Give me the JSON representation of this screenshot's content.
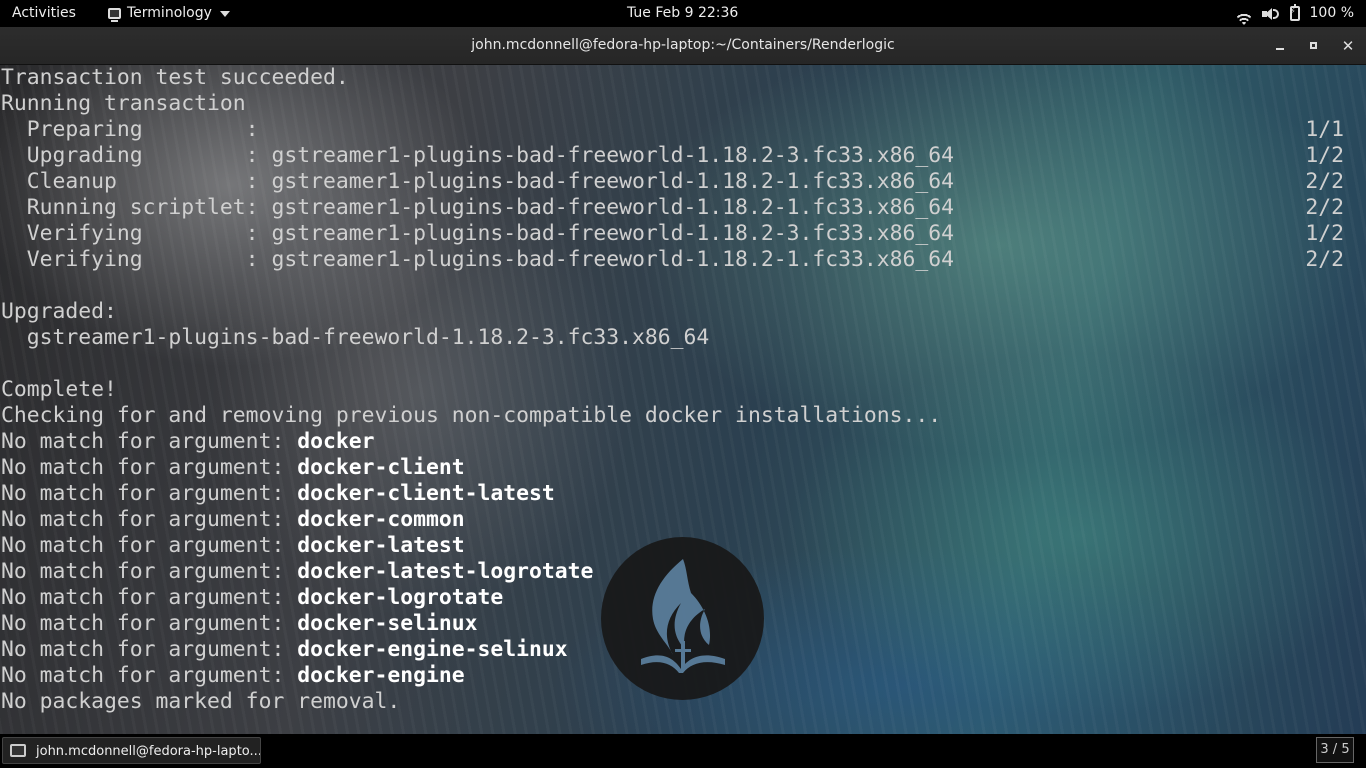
{
  "topbar": {
    "activities": "Activities",
    "app_name": "Terminology",
    "clock": "Tue Feb 9  22:36",
    "battery": "100 %"
  },
  "window": {
    "title": "john.mcdonnell@fedora-hp-laptop:~/Containers/Renderlogic"
  },
  "terminal": {
    "lines": [
      {
        "text": "Transaction test succeeded.",
        "bold": "",
        "right": ""
      },
      {
        "text": "Running transaction",
        "bold": "",
        "right": ""
      },
      {
        "text": "  Preparing        :",
        "bold": "",
        "right": "1/1"
      },
      {
        "text": "  Upgrading        : gstreamer1-plugins-bad-freeworld-1.18.2-3.fc33.x86_64",
        "bold": "",
        "right": "1/2"
      },
      {
        "text": "  Cleanup          : gstreamer1-plugins-bad-freeworld-1.18.2-1.fc33.x86_64",
        "bold": "",
        "right": "2/2"
      },
      {
        "text": "  Running scriptlet: gstreamer1-plugins-bad-freeworld-1.18.2-1.fc33.x86_64",
        "bold": "",
        "right": "2/2"
      },
      {
        "text": "  Verifying        : gstreamer1-plugins-bad-freeworld-1.18.2-3.fc33.x86_64",
        "bold": "",
        "right": "1/2"
      },
      {
        "text": "  Verifying        : gstreamer1-plugins-bad-freeworld-1.18.2-1.fc33.x86_64",
        "bold": "",
        "right": "2/2"
      },
      {
        "text": "",
        "bold": "",
        "right": ""
      },
      {
        "text": "Upgraded:",
        "bold": "",
        "right": ""
      },
      {
        "text": "  gstreamer1-plugins-bad-freeworld-1.18.2-3.fc33.x86_64",
        "bold": "",
        "right": ""
      },
      {
        "text": "",
        "bold": "",
        "right": ""
      },
      {
        "text": "Complete!",
        "bold": "",
        "right": ""
      },
      {
        "text": "Checking for and removing previous non-compatible docker installations...",
        "bold": "",
        "right": ""
      },
      {
        "text": "No match for argument: ",
        "bold": "docker",
        "right": ""
      },
      {
        "text": "No match for argument: ",
        "bold": "docker-client",
        "right": ""
      },
      {
        "text": "No match for argument: ",
        "bold": "docker-client-latest",
        "right": ""
      },
      {
        "text": "No match for argument: ",
        "bold": "docker-common",
        "right": ""
      },
      {
        "text": "No match for argument: ",
        "bold": "docker-latest",
        "right": ""
      },
      {
        "text": "No match for argument: ",
        "bold": "docker-latest-logrotate",
        "right": ""
      },
      {
        "text": "No match for argument: ",
        "bold": "docker-logrotate",
        "right": ""
      },
      {
        "text": "No match for argument: ",
        "bold": "docker-selinux",
        "right": ""
      },
      {
        "text": "No match for argument: ",
        "bold": "docker-engine-selinux",
        "right": ""
      },
      {
        "text": "No match for argument: ",
        "bold": "docker-engine",
        "right": ""
      },
      {
        "text": "No packages marked for removal.",
        "bold": "",
        "right": ""
      }
    ]
  },
  "taskbar": {
    "task_label": "john.mcdonnell@fedora-hp-lapto...",
    "workspace": "3 / 5"
  },
  "colors": {
    "terminal_text": "#d0d0d0",
    "terminal_bold": "#ffffff",
    "panel_bg": "#000000",
    "titlebar_bg": "#2d2d2d"
  }
}
